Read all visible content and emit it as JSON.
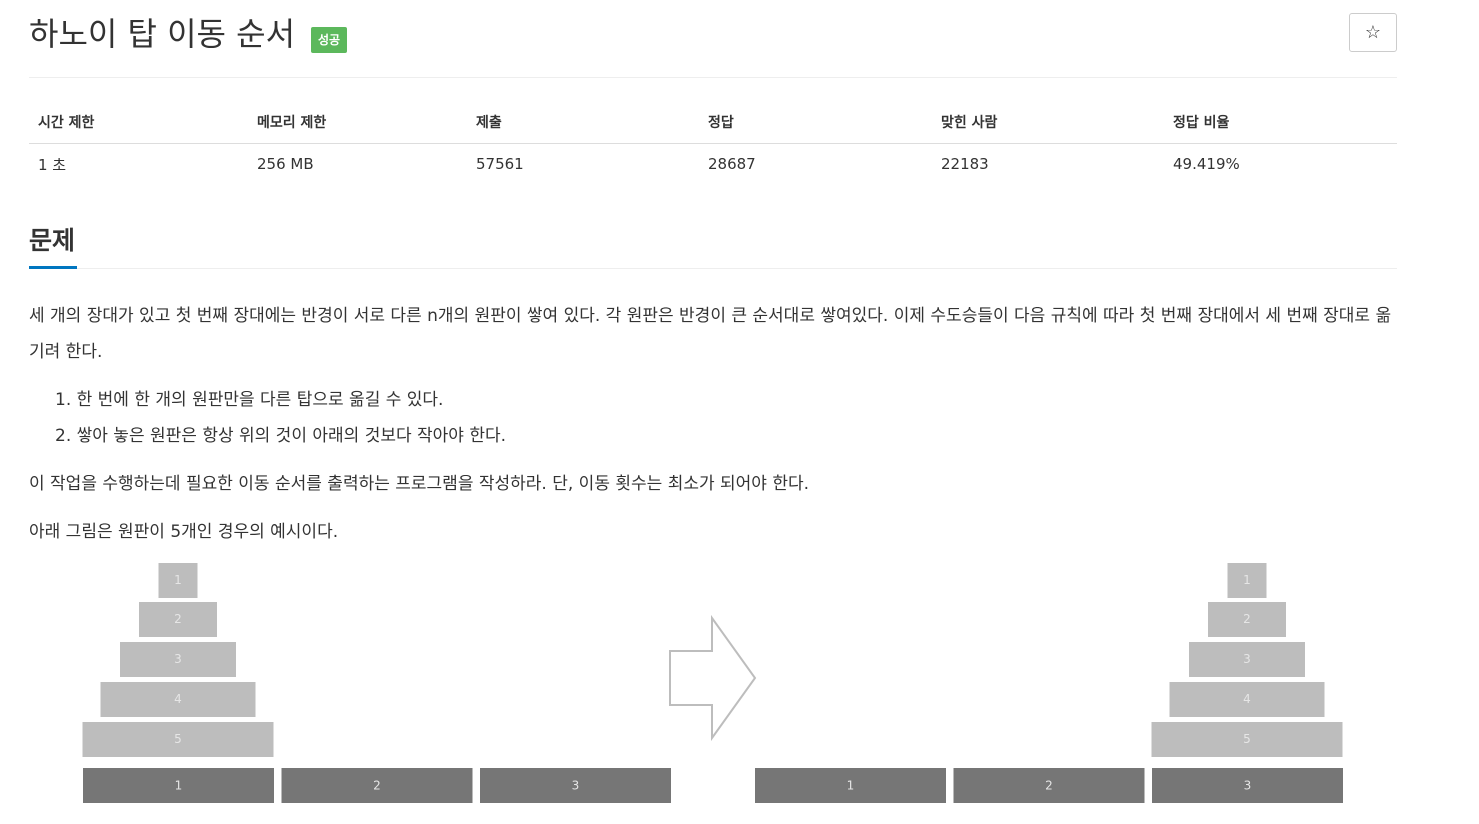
{
  "problem": {
    "title": "하노이 탑 이동 순서",
    "badge": "성공",
    "star_icon": "star-icon"
  },
  "stats": {
    "headers": [
      "시간 제한",
      "메모리 제한",
      "제출",
      "정답",
      "맞힌 사람",
      "정답 비율"
    ],
    "values": [
      "1 초",
      "256 MB",
      "57561",
      "28687",
      "22183",
      "49.419%"
    ]
  },
  "section": {
    "title": "문제"
  },
  "description": {
    "p1": "세 개의 장대가 있고 첫 번째 장대에는 반경이 서로 다른 n개의 원판이 쌓여 있다. 각 원판은 반경이 큰 순서대로 쌓여있다. 이제 수도승들이 다음 규칙에 따라 첫 번째 장대에서 세 번째 장대로 옮기려 한다.",
    "rules": [
      "1. 한 번에 한 개의 원판만을 다른 탑으로 옮길 수 있다.",
      "2. 쌓아 놓은 원판은 항상 위의 것이 아래의 것보다 작아야 한다."
    ],
    "p2": "이 작업을 수행하는데 필요한 이동 순서를 출력하는 프로그램을 작성하라. 단, 이동 횟수는 최소가 되어야 한다.",
    "p3": "아래 그림은 원판이 5개인 경우의 예시이다."
  },
  "figure": {
    "disk_labels": [
      "1",
      "2",
      "3",
      "4",
      "5"
    ],
    "peg_labels": [
      "1",
      "2",
      "3"
    ],
    "arrow_icon": "right-arrow-icon",
    "colors": {
      "disk": "#bdbdbd",
      "peg": "#767676",
      "label": "#e6e6e6"
    }
  }
}
